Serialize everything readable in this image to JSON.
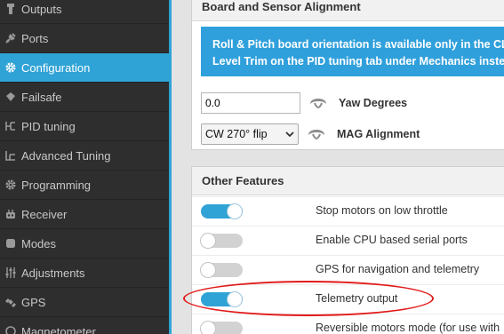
{
  "sidebar": {
    "items": [
      {
        "label": "Outputs",
        "icon": "outputs-icon"
      },
      {
        "label": "Ports",
        "icon": "plug-icon"
      },
      {
        "label": "Configuration",
        "icon": "gear-icon",
        "active": true
      },
      {
        "label": "Failsafe",
        "icon": "failsafe-icon"
      },
      {
        "label": "PID tuning",
        "icon": "pid-icon"
      },
      {
        "label": "Advanced Tuning",
        "icon": "advanced-tuning-icon"
      },
      {
        "label": "Programming",
        "icon": "gear-icon"
      },
      {
        "label": "Receiver",
        "icon": "receiver-icon"
      },
      {
        "label": "Modes",
        "icon": "modes-icon"
      },
      {
        "label": "Adjustments",
        "icon": "sliders-icon"
      },
      {
        "label": "GPS",
        "icon": "satellite-icon"
      },
      {
        "label": "Magnetometer",
        "icon": "compass-icon"
      }
    ]
  },
  "board_alignment": {
    "title": "Board and Sensor Alignment",
    "info_line1": "Roll & Pitch board orientation is available only in the CLI. ",
    "info_line2": "Level Trim on the PID tuning tab under Mechanics instead.",
    "yaw_value": "0.0",
    "yaw_label": "Yaw Degrees",
    "mag_value": "CW 270° flip",
    "mag_label": "MAG Alignment"
  },
  "other_features": {
    "title": "Other Features",
    "items": [
      {
        "label": "Stop motors on low throttle",
        "enabled": true
      },
      {
        "label": "Enable CPU based serial ports",
        "enabled": false
      },
      {
        "label": "GPS for navigation and telemetry",
        "enabled": false
      },
      {
        "label": "Telemetry output",
        "enabled": true
      },
      {
        "label": "Reversible motors mode (for use with",
        "enabled": false
      }
    ]
  },
  "colors": {
    "accent": "#2fa3d6",
    "sidebar_bg": "#2e2e2e",
    "highlight_ellipse": "#e11a1a"
  }
}
